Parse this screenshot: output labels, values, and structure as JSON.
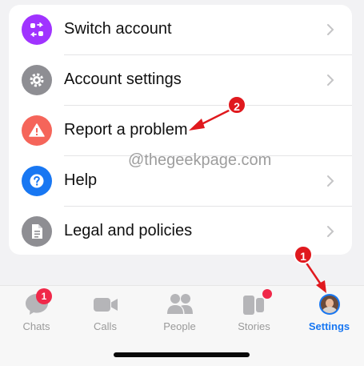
{
  "menu": {
    "items": [
      {
        "label": "Switch account",
        "icon": "switch-account-icon",
        "icon_color": "#a033ff",
        "has_chevron": true
      },
      {
        "label": "Account settings",
        "icon": "gear-icon",
        "icon_color": "#8e8e93",
        "has_chevron": true
      },
      {
        "label": "Report a problem",
        "icon": "warning-icon",
        "icon_color": "#f5655a",
        "has_chevron": false
      },
      {
        "label": "Help",
        "icon": "help-icon",
        "icon_color": "#1877f2",
        "has_chevron": true
      },
      {
        "label": "Legal and policies",
        "icon": "document-icon",
        "icon_color": "#8e8e93",
        "has_chevron": true
      }
    ]
  },
  "watermark": "@thegeekpage.com",
  "tabbar": {
    "tabs": [
      {
        "label": "Chats",
        "icon": "chat-bubble-icon",
        "badge": "1",
        "active": false
      },
      {
        "label": "Calls",
        "icon": "video-camera-icon",
        "active": false
      },
      {
        "label": "People",
        "icon": "people-icon",
        "active": false
      },
      {
        "label": "Stories",
        "icon": "stories-icon",
        "dot_badge": true,
        "active": false
      },
      {
        "label": "Settings",
        "icon": "avatar",
        "active": true
      }
    ],
    "active_color": "#1877f2",
    "inactive_color": "#9a9a9a",
    "badge_color": "#f02849"
  },
  "annotations": {
    "marker_1": "1",
    "marker_2": "2",
    "marker_color": "#e0191e"
  }
}
